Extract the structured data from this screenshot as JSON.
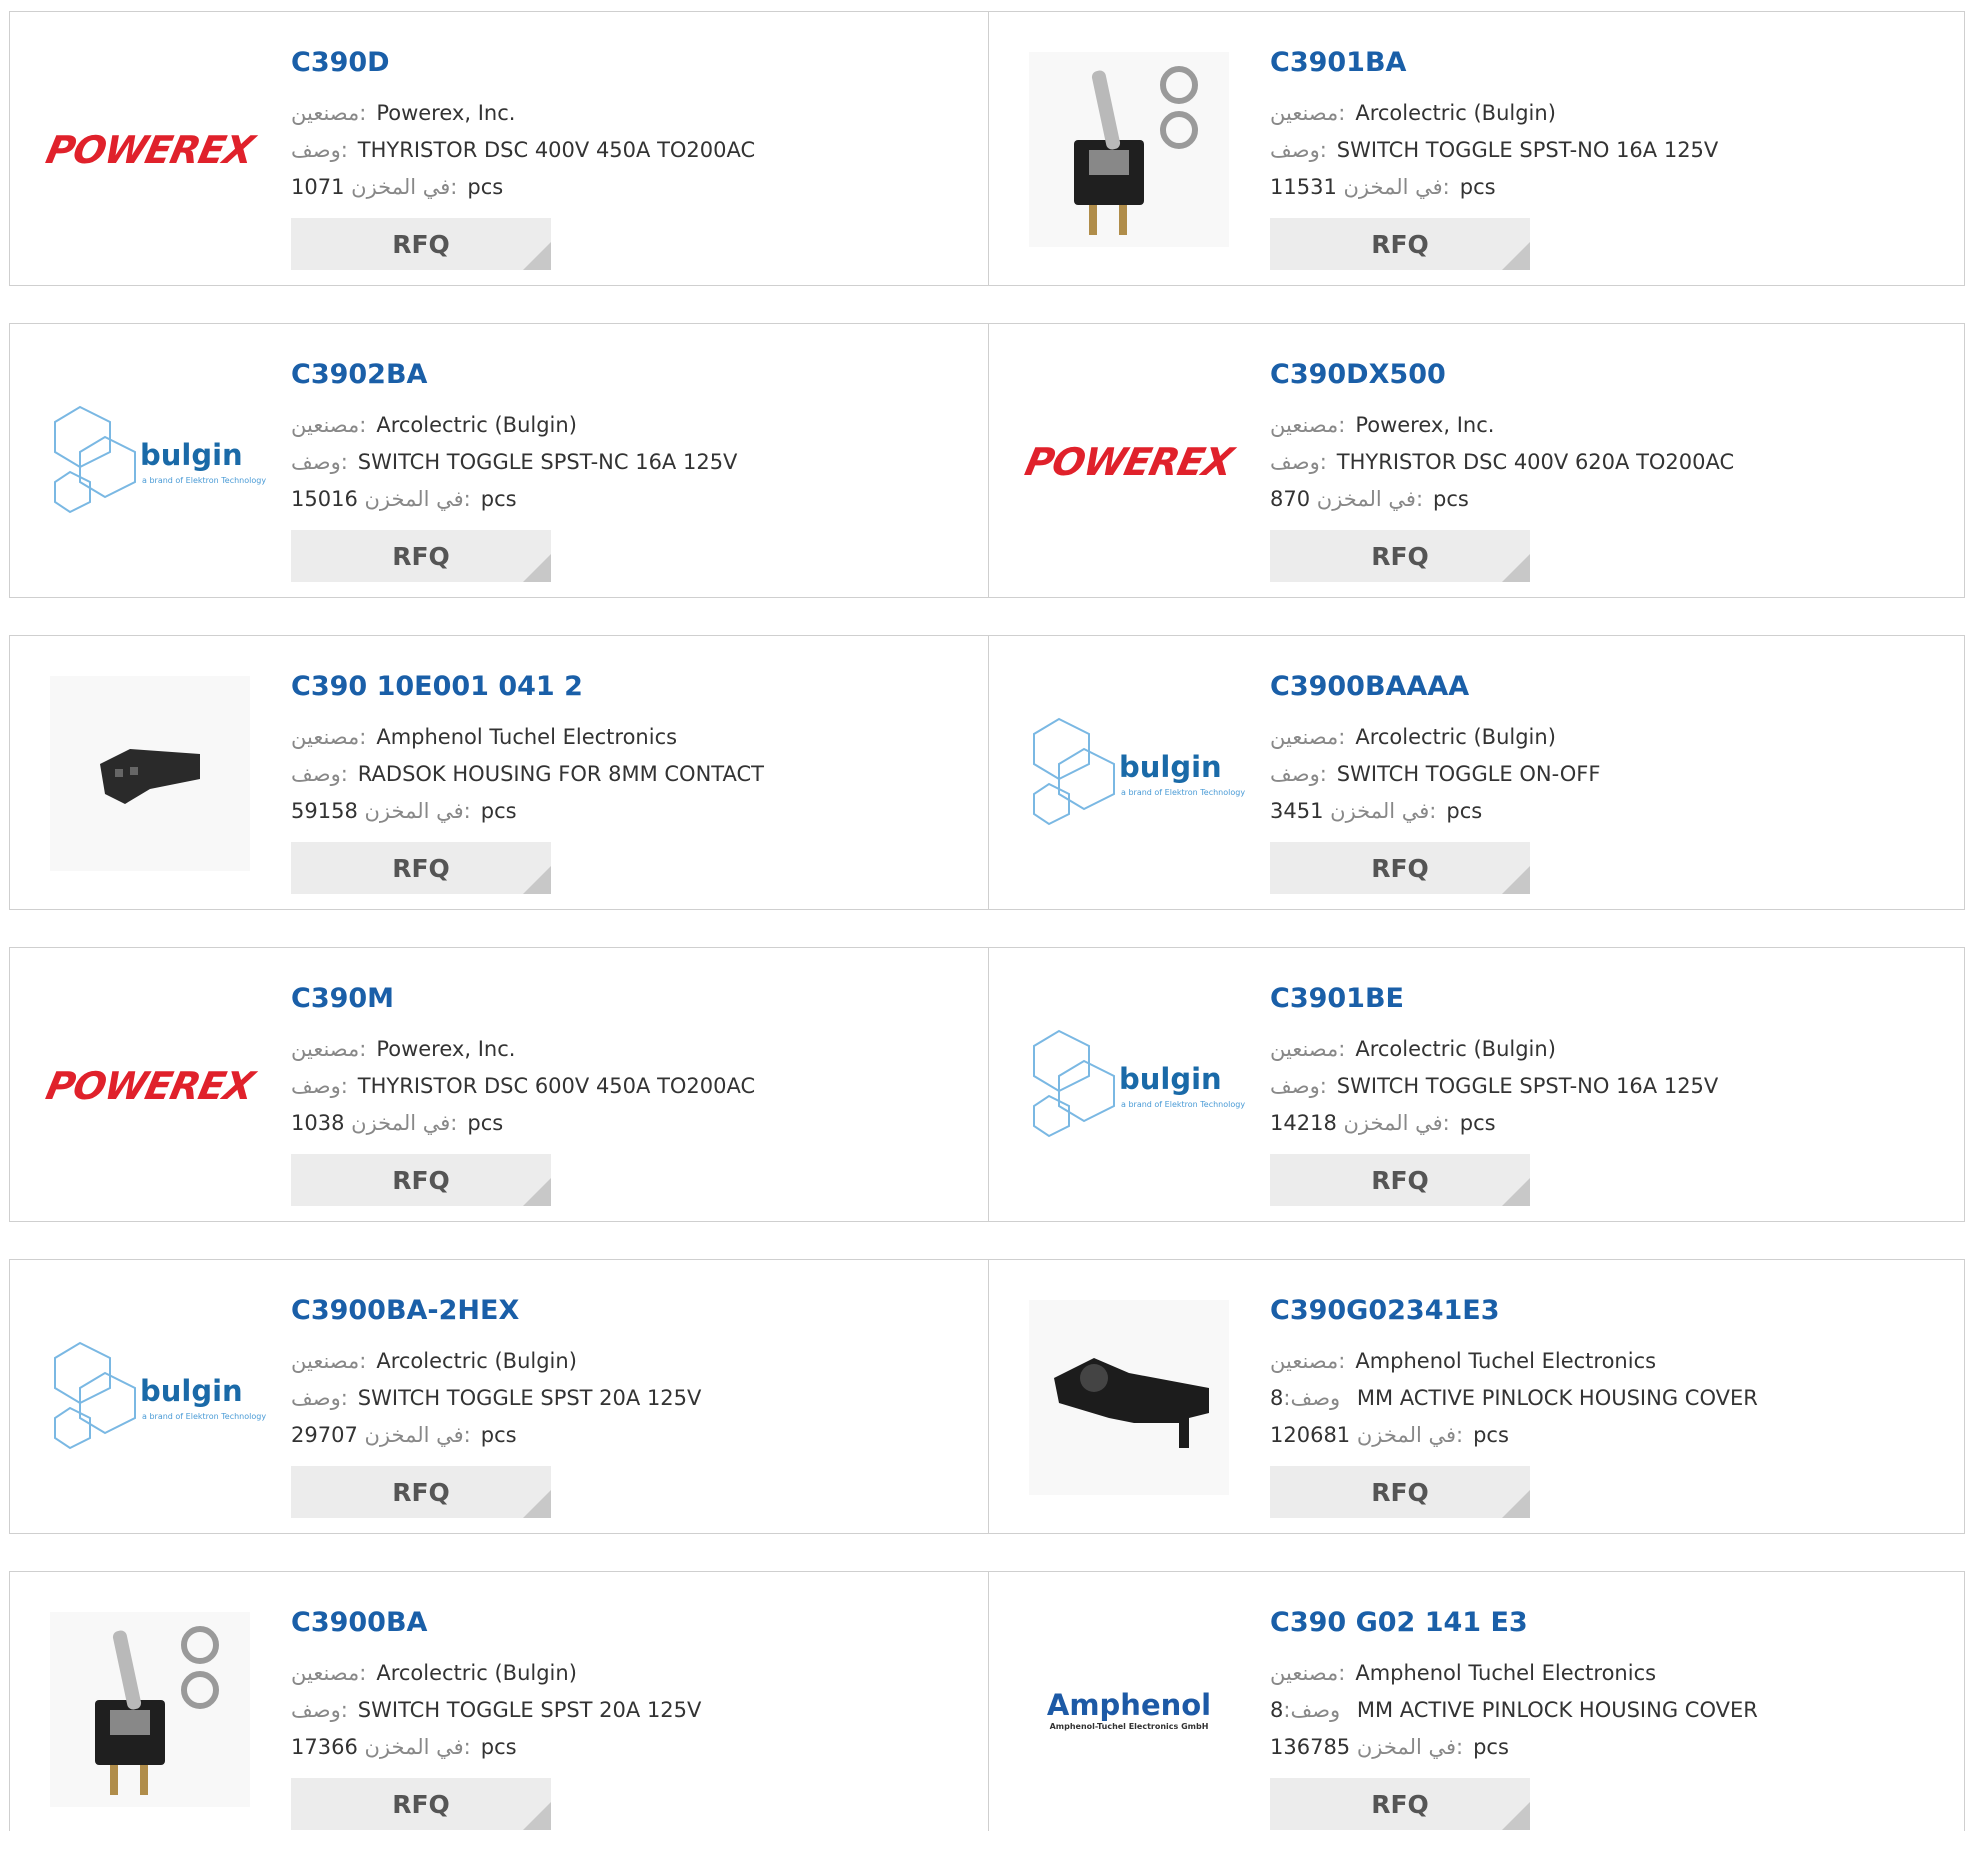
{
  "labels": {
    "manufacturer": "مصنعين:",
    "description": "وصف:",
    "stock": "في المخزن:",
    "unit": "pcs",
    "rfq": "RFQ"
  },
  "products": [
    {
      "part": "C390D",
      "manufacturer": "Powerex, Inc.",
      "description": "THYRISTOR DSC 400V 450A TO200AC",
      "stock": "1071",
      "logo": "powerex"
    },
    {
      "part": "C3901BA",
      "manufacturer": "Arcolectric (Bulgin)",
      "description": "SWITCH TOGGLE SPST-NO 16A 125V",
      "stock": "11531",
      "logo": "toggle-photo"
    },
    {
      "part": "C3902BA",
      "manufacturer": "Arcolectric (Bulgin)",
      "description": "SWITCH TOGGLE SPST-NC 16A 125V",
      "stock": "15016",
      "logo": "bulgin"
    },
    {
      "part": "C390DX500",
      "manufacturer": "Powerex, Inc.",
      "description": "THYRISTOR DSC 400V 620A TO200AC",
      "stock": "870",
      "logo": "powerex"
    },
    {
      "part": "C390 10E001 041 2",
      "manufacturer": "Amphenol Tuchel Electronics",
      "description": "RADSOK HOUSING FOR 8MM CONTACT",
      "stock": "59158",
      "logo": "housing-photo"
    },
    {
      "part": "C3900BAAAA",
      "manufacturer": "Arcolectric (Bulgin)",
      "description": "SWITCH TOGGLE ON-OFF",
      "stock": "3451",
      "logo": "bulgin"
    },
    {
      "part": "C390M",
      "manufacturer": "Powerex, Inc.",
      "description": "THYRISTOR DSC 600V 450A TO200AC",
      "stock": "1038",
      "logo": "powerex"
    },
    {
      "part": "C3901BE",
      "manufacturer": "Arcolectric (Bulgin)",
      "description": "SWITCH TOGGLE SPST-NO 16A 125V",
      "stock": "14218",
      "logo": "bulgin"
    },
    {
      "part": "C3900BA-2HEX",
      "manufacturer": "Arcolectric (Bulgin)",
      "description": "SWITCH TOGGLE SPST 20A 125V",
      "stock": "29707",
      "logo": "bulgin"
    },
    {
      "part": "C390G02341E3",
      "manufacturer": "Amphenol Tuchel Electronics",
      "description": "8 MM ACTIVE PINLOCK HOUSING COVER",
      "stock": "120681",
      "logo": "cover-photo"
    },
    {
      "part": "C3900BA",
      "manufacturer": "Arcolectric (Bulgin)",
      "description": "SWITCH TOGGLE SPST 20A 125V",
      "stock": "17366",
      "logo": "toggle-photo"
    },
    {
      "part": "C390 G02 141 E3",
      "manufacturer": "Amphenol Tuchel Electronics",
      "description": "8 MM ACTIVE PINLOCK HOUSING COVER",
      "stock": "136785",
      "logo": "amphenol"
    }
  ],
  "logos": {
    "powerex_text": "POWEREX",
    "bulgin_text": "bulgin",
    "bulgin_sub": "a brand of Elektron Technology",
    "amphenol_text": "Amphenol",
    "amphenol_sub": "Amphenol-Tuchel Electronics GmbH"
  },
  "colors": {
    "link": "#1a5fa8",
    "powerex_red": "#e0212b",
    "bulgin_blue": "#1a6aa8",
    "rfq_bg": "#ececec"
  }
}
